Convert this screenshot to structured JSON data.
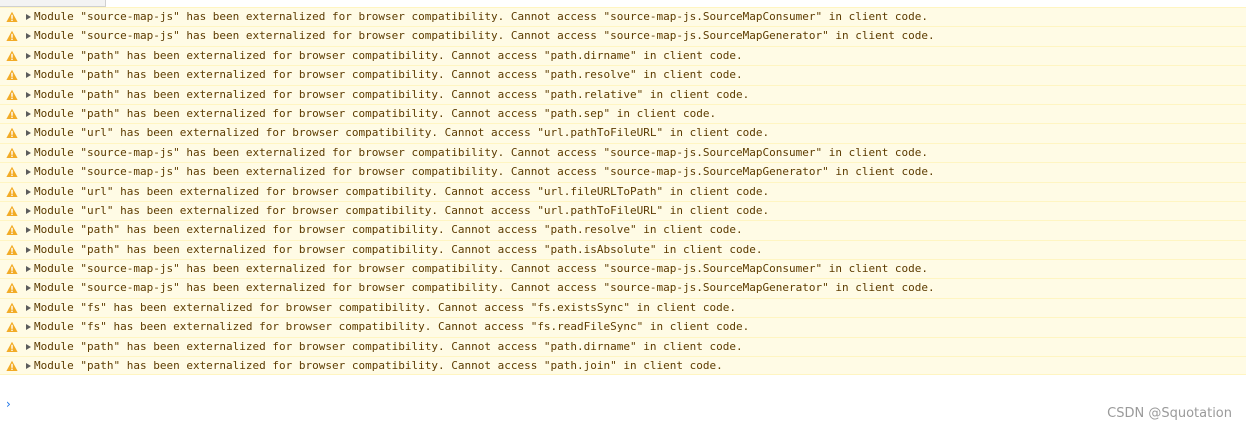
{
  "console": {
    "messages": [
      {
        "level": "warning",
        "icon": "warning-icon",
        "text": "Module \"source-map-js\" has been externalized for browser compatibility. Cannot access \"source-map-js.SourceMapConsumer\" in client code."
      },
      {
        "level": "warning",
        "icon": "warning-icon",
        "text": "Module \"source-map-js\" has been externalized for browser compatibility. Cannot access \"source-map-js.SourceMapGenerator\" in client code."
      },
      {
        "level": "warning",
        "icon": "warning-icon",
        "text": "Module \"path\" has been externalized for browser compatibility. Cannot access \"path.dirname\" in client code."
      },
      {
        "level": "warning",
        "icon": "warning-icon",
        "text": "Module \"path\" has been externalized for browser compatibility. Cannot access \"path.resolve\" in client code."
      },
      {
        "level": "warning",
        "icon": "warning-icon",
        "text": "Module \"path\" has been externalized for browser compatibility. Cannot access \"path.relative\" in client code."
      },
      {
        "level": "warning",
        "icon": "warning-icon",
        "text": "Module \"path\" has been externalized for browser compatibility. Cannot access \"path.sep\" in client code."
      },
      {
        "level": "warning",
        "icon": "warning-icon",
        "text": "Module \"url\" has been externalized for browser compatibility. Cannot access \"url.pathToFileURL\" in client code."
      },
      {
        "level": "warning",
        "icon": "warning-icon",
        "text": "Module \"source-map-js\" has been externalized for browser compatibility. Cannot access \"source-map-js.SourceMapConsumer\" in client code."
      },
      {
        "level": "warning",
        "icon": "warning-icon",
        "text": "Module \"source-map-js\" has been externalized for browser compatibility. Cannot access \"source-map-js.SourceMapGenerator\" in client code."
      },
      {
        "level": "warning",
        "icon": "warning-icon",
        "text": "Module \"url\" has been externalized for browser compatibility. Cannot access \"url.fileURLToPath\" in client code."
      },
      {
        "level": "warning",
        "icon": "warning-icon",
        "text": "Module \"url\" has been externalized for browser compatibility. Cannot access \"url.pathToFileURL\" in client code."
      },
      {
        "level": "warning",
        "icon": "warning-icon",
        "text": "Module \"path\" has been externalized for browser compatibility. Cannot access \"path.resolve\" in client code."
      },
      {
        "level": "warning",
        "icon": "warning-icon",
        "text": "Module \"path\" has been externalized for browser compatibility. Cannot access \"path.isAbsolute\" in client code."
      },
      {
        "level": "warning",
        "icon": "warning-icon",
        "text": "Module \"source-map-js\" has been externalized for browser compatibility. Cannot access \"source-map-js.SourceMapConsumer\" in client code."
      },
      {
        "level": "warning",
        "icon": "warning-icon",
        "text": "Module \"source-map-js\" has been externalized for browser compatibility. Cannot access \"source-map-js.SourceMapGenerator\" in client code."
      },
      {
        "level": "warning",
        "icon": "warning-icon",
        "text": "Module \"fs\" has been externalized for browser compatibility. Cannot access \"fs.existsSync\" in client code."
      },
      {
        "level": "warning",
        "icon": "warning-icon",
        "text": "Module \"fs\" has been externalized for browser compatibility. Cannot access \"fs.readFileSync\" in client code."
      },
      {
        "level": "warning",
        "icon": "warning-icon",
        "text": "Module \"path\" has been externalized for browser compatibility. Cannot access \"path.dirname\" in client code."
      },
      {
        "level": "warning",
        "icon": "warning-icon",
        "text": "Module \"path\" has been externalized for browser compatibility. Cannot access \"path.join\" in client code."
      }
    ],
    "prompt": {
      "symbol": "›",
      "icon": "chevron-right-icon"
    }
  },
  "watermark": "CSDN @Squotation",
  "colors": {
    "warning_background": "#fffbe5",
    "warning_border": "#fff5c2",
    "warning_text": "#5c3b00",
    "warning_icon": "#f2ab26",
    "prompt_accent": "#1a73e8"
  }
}
